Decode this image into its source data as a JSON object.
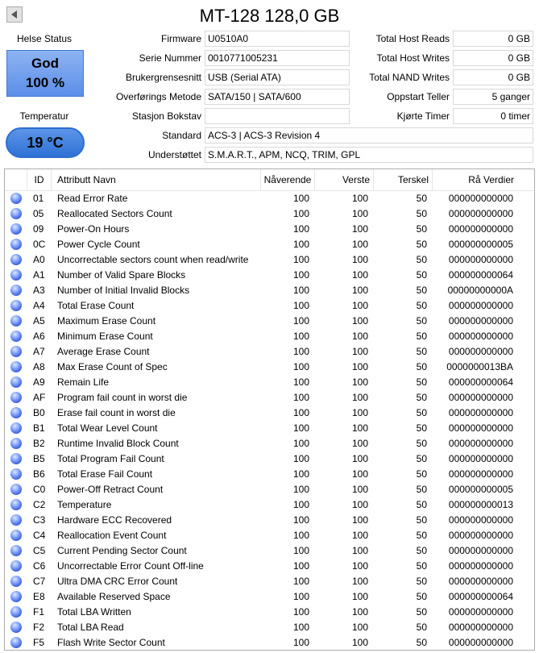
{
  "window": {
    "title": "MT-128 128,0 GB"
  },
  "status": {
    "health_label": "Helse Status",
    "health_text": "God",
    "health_percent": "100 %",
    "health_color": "#6a9cf0",
    "temp_label": "Temperatur",
    "temp_value": "19 °C",
    "temp_color": "#3a7ddc"
  },
  "info": {
    "firmware_label": "Firmware",
    "firmware": "U0510A0",
    "serial_label": "Serie Nummer",
    "serial": "0010771005231",
    "interface_label": "Brukergrensesnitt",
    "interface": "USB (Serial ATA)",
    "transfer_label": "Overførings Metode",
    "transfer": "SATA/150 | SATA/600",
    "drive_letter_label": "Stasjon Bokstav",
    "drive_letter": "",
    "standard_label": "Standard",
    "standard": "ACS-3 | ACS-3 Revision 4",
    "features_label": "Understøttet",
    "features": "S.M.A.R.T., APM, NCQ, TRIM, GPL"
  },
  "stats": {
    "host_reads_label": "Total Host Reads",
    "host_reads": "0 GB",
    "host_writes_label": "Total Host Writes",
    "host_writes": "0 GB",
    "nand_writes_label": "Total NAND Writes",
    "nand_writes": "0 GB",
    "power_on_count_label": "Oppstart Teller",
    "power_on_count": "5 ganger",
    "power_on_hours_label": "Kjørte Timer",
    "power_on_hours": "0 timer"
  },
  "table": {
    "headers": {
      "id": "ID",
      "name": "Attributt Navn",
      "current": "Nåverende",
      "worst": "Verste",
      "threshold": "Terskel",
      "raw": "Rå Verdier"
    },
    "rows": [
      {
        "id": "01",
        "name": "Read Error Rate",
        "current": "100",
        "worst": "100",
        "threshold": "50",
        "raw": "000000000000"
      },
      {
        "id": "05",
        "name": "Reallocated Sectors Count",
        "current": "100",
        "worst": "100",
        "threshold": "50",
        "raw": "000000000000"
      },
      {
        "id": "09",
        "name": "Power-On Hours",
        "current": "100",
        "worst": "100",
        "threshold": "50",
        "raw": "000000000000"
      },
      {
        "id": "0C",
        "name": "Power Cycle Count",
        "current": "100",
        "worst": "100",
        "threshold": "50",
        "raw": "000000000005"
      },
      {
        "id": "A0",
        "name": "Uncorrectable sectors count when read/write",
        "current": "100",
        "worst": "100",
        "threshold": "50",
        "raw": "000000000000"
      },
      {
        "id": "A1",
        "name": "Number of Valid Spare Blocks",
        "current": "100",
        "worst": "100",
        "threshold": "50",
        "raw": "000000000064"
      },
      {
        "id": "A3",
        "name": "Number of Initial Invalid Blocks",
        "current": "100",
        "worst": "100",
        "threshold": "50",
        "raw": "00000000000A"
      },
      {
        "id": "A4",
        "name": "Total Erase Count",
        "current": "100",
        "worst": "100",
        "threshold": "50",
        "raw": "000000000000"
      },
      {
        "id": "A5",
        "name": "Maximum Erase Count",
        "current": "100",
        "worst": "100",
        "threshold": "50",
        "raw": "000000000000"
      },
      {
        "id": "A6",
        "name": "Minimum Erase Count",
        "current": "100",
        "worst": "100",
        "threshold": "50",
        "raw": "000000000000"
      },
      {
        "id": "A7",
        "name": "Average Erase Count",
        "current": "100",
        "worst": "100",
        "threshold": "50",
        "raw": "000000000000"
      },
      {
        "id": "A8",
        "name": "Max Erase Count of Spec",
        "current": "100",
        "worst": "100",
        "threshold": "50",
        "raw": "0000000013BA"
      },
      {
        "id": "A9",
        "name": "Remain Life",
        "current": "100",
        "worst": "100",
        "threshold": "50",
        "raw": "000000000064"
      },
      {
        "id": "AF",
        "name": "Program fail count in worst die",
        "current": "100",
        "worst": "100",
        "threshold": "50",
        "raw": "000000000000"
      },
      {
        "id": "B0",
        "name": "Erase fail count in worst die",
        "current": "100",
        "worst": "100",
        "threshold": "50",
        "raw": "000000000000"
      },
      {
        "id": "B1",
        "name": "Total Wear Level Count",
        "current": "100",
        "worst": "100",
        "threshold": "50",
        "raw": "000000000000"
      },
      {
        "id": "B2",
        "name": "Runtime Invalid Block Count",
        "current": "100",
        "worst": "100",
        "threshold": "50",
        "raw": "000000000000"
      },
      {
        "id": "B5",
        "name": "Total Program Fail Count",
        "current": "100",
        "worst": "100",
        "threshold": "50",
        "raw": "000000000000"
      },
      {
        "id": "B6",
        "name": "Total Erase Fail Count",
        "current": "100",
        "worst": "100",
        "threshold": "50",
        "raw": "000000000000"
      },
      {
        "id": "C0",
        "name": "Power-Off Retract Count",
        "current": "100",
        "worst": "100",
        "threshold": "50",
        "raw": "000000000005"
      },
      {
        "id": "C2",
        "name": "Temperature",
        "current": "100",
        "worst": "100",
        "threshold": "50",
        "raw": "000000000013"
      },
      {
        "id": "C3",
        "name": "Hardware ECC Recovered",
        "current": "100",
        "worst": "100",
        "threshold": "50",
        "raw": "000000000000"
      },
      {
        "id": "C4",
        "name": "Reallocation Event Count",
        "current": "100",
        "worst": "100",
        "threshold": "50",
        "raw": "000000000000"
      },
      {
        "id": "C5",
        "name": "Current Pending Sector Count",
        "current": "100",
        "worst": "100",
        "threshold": "50",
        "raw": "000000000000"
      },
      {
        "id": "C6",
        "name": "Uncorrectable Error Count Off-line",
        "current": "100",
        "worst": "100",
        "threshold": "50",
        "raw": "000000000000"
      },
      {
        "id": "C7",
        "name": "Ultra DMA CRC Error Count",
        "current": "100",
        "worst": "100",
        "threshold": "50",
        "raw": "000000000000"
      },
      {
        "id": "E8",
        "name": "Available Reserved Space",
        "current": "100",
        "worst": "100",
        "threshold": "50",
        "raw": "000000000064"
      },
      {
        "id": "F1",
        "name": "Total LBA Written",
        "current": "100",
        "worst": "100",
        "threshold": "50",
        "raw": "000000000000"
      },
      {
        "id": "F2",
        "name": "Total LBA Read",
        "current": "100",
        "worst": "100",
        "threshold": "50",
        "raw": "000000000000"
      },
      {
        "id": "F5",
        "name": "Flash Write Sector Count",
        "current": "100",
        "worst": "100",
        "threshold": "50",
        "raw": "000000000000"
      }
    ]
  }
}
